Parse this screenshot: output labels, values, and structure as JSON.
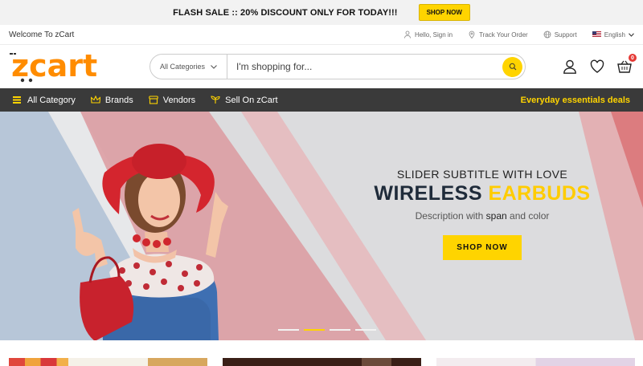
{
  "flash": {
    "text": "FLASH SALE :: 20% DISCOUNT ONLY FOR TODAY!!!",
    "button": "SHOP NOW"
  },
  "topbar": {
    "welcome": "Welcome To zCart",
    "links": [
      {
        "icon": "user-icon",
        "label": "Hello, Sign in"
      },
      {
        "icon": "location-pin-icon",
        "label": "Track Your Order"
      },
      {
        "icon": "globe-icon",
        "label": "Support"
      }
    ],
    "language": "English"
  },
  "header": {
    "logo": "zcart",
    "category_select": "All Categories",
    "search_placeholder": "I'm shopping for...",
    "cart_count": "0"
  },
  "nav": {
    "items": [
      {
        "icon": "menu-icon",
        "label": "All Category"
      },
      {
        "icon": "crown-icon",
        "label": "Brands"
      },
      {
        "icon": "store-icon",
        "label": "Vendors"
      },
      {
        "icon": "sprout-icon",
        "label": "Sell On zCart"
      }
    ],
    "deals": "Everyday essentials deals"
  },
  "hero": {
    "subtitle": "SLIDER SUBTITLE WITH LOVE",
    "title_part1": "WIRELESS",
    "title_part2": "EARBUDS",
    "desc_before": "Description with",
    "desc_span": "span",
    "desc_after": "and color",
    "button": "SHOP NOW",
    "slides": 4,
    "active_slide": 2
  },
  "colors": {
    "accent": "#ffd400",
    "brand": "#ff8c00",
    "nav_bg": "#3a3a3a",
    "title_dark": "#1f2b3a"
  }
}
